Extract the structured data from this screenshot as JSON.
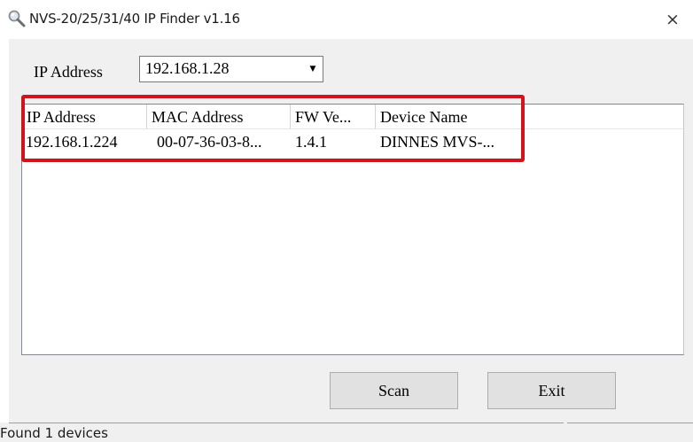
{
  "window": {
    "title": "NVS-20/25/31/40 IP Finder v1.16",
    "close_glyph": "×",
    "icon": "magnifier-icon"
  },
  "ip_selector": {
    "label": "IP Address",
    "value": "192.168.1.28",
    "arrow_glyph": "▼"
  },
  "device_list": {
    "columns": [
      "IP Address",
      "MAC Address",
      "FW Ve...",
      "Device Name"
    ],
    "rows": [
      [
        "192.168.1.224",
        "00-07-36-03-8...",
        "1.4.1",
        "DINNES MVS-..."
      ]
    ]
  },
  "buttons": {
    "scan": "Scan",
    "exit": "Exit"
  },
  "status": {
    "text": "Found 1 devices"
  },
  "colors": {
    "highlight": "#d0131c",
    "dialog_bg": "#f0f0f0"
  }
}
